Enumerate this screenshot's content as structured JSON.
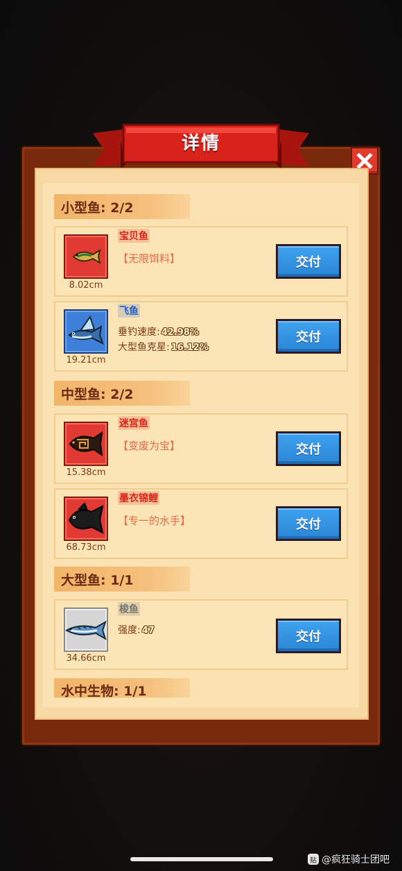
{
  "dialog": {
    "title": "详情",
    "close_icon": "close-x-icon",
    "accent_red": "#e23a2a",
    "button_blue": "#2a86d6"
  },
  "sections": [
    {
      "label": "小型鱼: 2/2"
    },
    {
      "label": "中型鱼: 2/2"
    },
    {
      "label": "大型鱼: 1/1"
    },
    {
      "label": "水中生物: 1/1"
    }
  ],
  "fish": [
    {
      "name": "宝贝鱼",
      "size": "8.02cm",
      "desc": "【无限饵料】",
      "rarity": "red",
      "icon": "golden-fish-icon",
      "button": "交付"
    },
    {
      "name": "飞鱼",
      "size": "19.21cm",
      "stat1_label": "垂钓速度:",
      "stat1_value": "42.98%",
      "stat2_label": "大型鱼克星:",
      "stat2_value": "16.12%",
      "rarity": "blue",
      "icon": "flying-fish-icon",
      "button": "交付"
    },
    {
      "name": "迷宫鱼",
      "size": "15.38cm",
      "desc": "【变废为宝】",
      "rarity": "red",
      "icon": "maze-fish-icon",
      "button": "交付"
    },
    {
      "name": "墨衣锦鲤",
      "size": "68.73cm",
      "desc": "【专一的水手】",
      "rarity": "red",
      "icon": "black-carp-icon",
      "button": "交付"
    },
    {
      "name": "梭鱼",
      "size": "34.66cm",
      "stat1_label": "强度:",
      "stat1_value": "47",
      "rarity": "gray",
      "icon": "barracuda-icon",
      "button": "交付"
    }
  ],
  "watermark": {
    "text": "@疯狂骑士团吧",
    "icon": "tieba-icon",
    "icon_glyph": "贴"
  }
}
